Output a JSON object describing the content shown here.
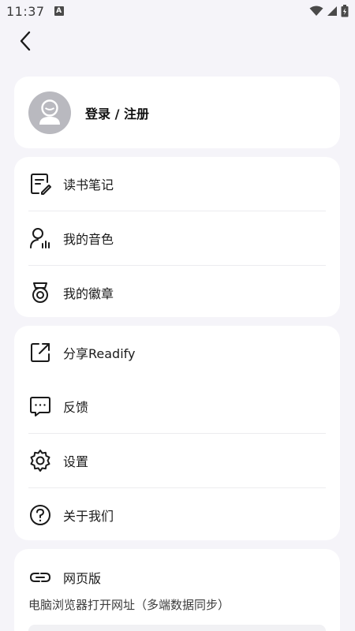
{
  "status_bar": {
    "time": "11:37",
    "notification_letter": "A"
  },
  "login": {
    "label": "登录 / 注册"
  },
  "group1": [
    {
      "label": "读书笔记",
      "icon": "note-icon"
    },
    {
      "label": "我的音色",
      "icon": "voice-icon"
    },
    {
      "label": "我的徽章",
      "icon": "badge-icon"
    }
  ],
  "group2": [
    {
      "label": "分享Readify",
      "icon": "share-icon"
    },
    {
      "label": "反馈",
      "icon": "feedback-icon"
    },
    {
      "label": "设置",
      "icon": "gear-icon"
    },
    {
      "label": "关于我们",
      "icon": "help-icon"
    }
  ],
  "web": {
    "label": "网页版",
    "description": "电脑浏览器打开网址（多端数据同步）"
  },
  "colors": {
    "background": "#f5f4f9",
    "card": "#ffffff",
    "avatar": "#b9b9bf",
    "text": "#1a1a1a"
  }
}
